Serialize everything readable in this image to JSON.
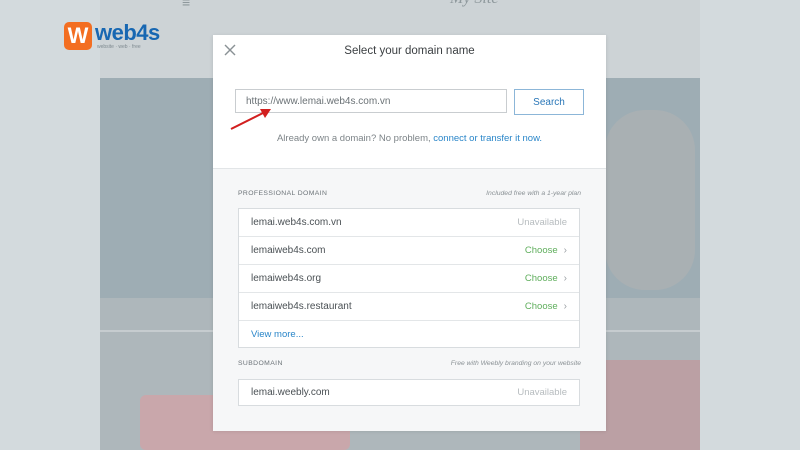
{
  "logo": {
    "letter": "W",
    "word": "web4s",
    "tagline": "website  ·  web  ·  free"
  },
  "background": {
    "ghost_text": "My Site",
    "ghost_mark": "≡"
  },
  "modal": {
    "title": "Select your domain name",
    "url_value": "https://www.lemai.web4s.com.vn",
    "search_label": "Search",
    "own_prefix": "Already own a domain? No problem, ",
    "own_link": "connect or transfer it now."
  },
  "professional": {
    "label": "PROFESSIONAL DOMAIN",
    "note": "Included free with a 1-year plan",
    "items": [
      {
        "name": "lemai.web4s.com.vn",
        "status": "Unavailable"
      },
      {
        "name": "lemaiweb4s.com",
        "status": "Choose"
      },
      {
        "name": "lemaiweb4s.org",
        "status": "Choose"
      },
      {
        "name": "lemaiweb4s.restaurant",
        "status": "Choose"
      }
    ],
    "view_more": "View more..."
  },
  "subdomain": {
    "label": "SUBDOMAIN",
    "note": "Free with Weebly branding on your website",
    "item": {
      "name": "lemai.weebly.com",
      "status": "Unavailable"
    }
  },
  "colors": {
    "accent": "#2a86c9",
    "choose": "#5fae5c",
    "logo_orange": "#f36e21",
    "logo_blue": "#1767b2",
    "arrow": "#d21f1f"
  }
}
